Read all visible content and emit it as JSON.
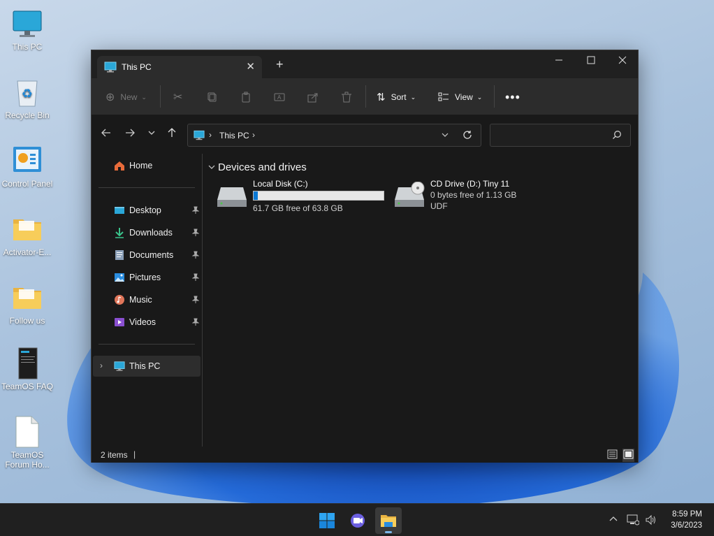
{
  "desktop": {
    "icons": [
      {
        "label": "This PC"
      },
      {
        "label": "Recycle Bin"
      },
      {
        "label": "Control Panel"
      },
      {
        "label": "Activator-E..."
      },
      {
        "label": "Follow us"
      },
      {
        "label": "TeamOS FAQ"
      },
      {
        "label": "TeamOS Forum Ho..."
      }
    ]
  },
  "window": {
    "tab_title": "This PC",
    "tab_icon": "monitor-icon",
    "toolbar": {
      "new_label": "New",
      "sort_label": "Sort",
      "view_label": "View",
      "disabled_actions": [
        "cut-icon",
        "copy-icon",
        "paste-icon",
        "rename-icon",
        "share-icon",
        "delete-icon"
      ]
    },
    "address": {
      "path": [
        "This PC"
      ]
    },
    "search": {
      "placeholder": "",
      "value": ""
    },
    "sidebar": {
      "home": "Home",
      "quick_access": [
        {
          "label": "Desktop",
          "icon": "desktop-folder-icon"
        },
        {
          "label": "Downloads",
          "icon": "download-icon"
        },
        {
          "label": "Documents",
          "icon": "documents-icon"
        },
        {
          "label": "Pictures",
          "icon": "pictures-icon"
        },
        {
          "label": "Music",
          "icon": "music-icon"
        },
        {
          "label": "Videos",
          "icon": "videos-icon"
        }
      ],
      "this_pc": "This PC"
    },
    "content": {
      "group_title": "Devices and drives",
      "drives": [
        {
          "name": "Local Disk (C:)",
          "detail": "61.7 GB free of 63.8 GB",
          "used_fraction": 0.033
        },
        {
          "name": "CD Drive (D:) Tiny 11",
          "detail": "0 bytes free of 1.13 GB",
          "fs": "UDF"
        }
      ]
    },
    "status": {
      "items": "2 items"
    }
  },
  "taskbar": {
    "time": "8:59 PM",
    "date": "3/6/2023"
  },
  "colors": {
    "accent": "#0a78d4",
    "window_bg": "#191919",
    "toolbar_bg": "#2c2c2c",
    "taskbar_bg": "#202020"
  }
}
